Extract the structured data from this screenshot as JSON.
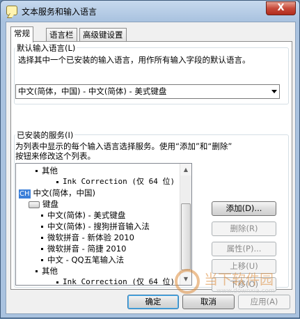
{
  "window": {
    "title": "文本服务和输入语言",
    "close_glyph": "X"
  },
  "tabs": [
    "常规",
    "语言栏",
    "高级键设置"
  ],
  "default_language": {
    "label": "默认输入语言(L)",
    "description": "选择其中一个已安装的输入语言，用作所有输入字段的默认语言。",
    "selected": "中文(简体，中国) - 中文(简体) - 美式键盘"
  },
  "installed_services": {
    "label": "已安装的服务(I)",
    "description_line1": "为列表中显示的每个输入语言选择服务。使用“添加”和“删除”",
    "description_line2": "按钮来修改这个列表。",
    "tree": {
      "other_header_1": "其他",
      "ink_1": "Ink Correction (仅 64 位)",
      "lang_badge": "CH",
      "lang_name": "中文(简体，中国)",
      "keyboard_header": "键盘",
      "keyboards": [
        "中文(简体) - 美式键盘",
        "中文(简体) - 搜狗拼音输入法",
        "微软拼音 - 新体验 2010",
        "微软拼音 - 简捷 2010",
        "中文 - QQ五笔输入法"
      ],
      "other_header_2": "其他",
      "ink_2": "Ink Correction (仅 64 位)"
    },
    "buttons": {
      "add": "添加(D)...",
      "remove": "删除(R)",
      "properties": "属性(P)...",
      "move_up": "上移(U)",
      "move_down": "下移(O)"
    }
  },
  "footer": {
    "ok": "确定",
    "cancel": "取消",
    "apply": "应用(A)"
  },
  "watermark": {
    "brand": "当下软件园",
    "url": "www.downxia.com"
  }
}
